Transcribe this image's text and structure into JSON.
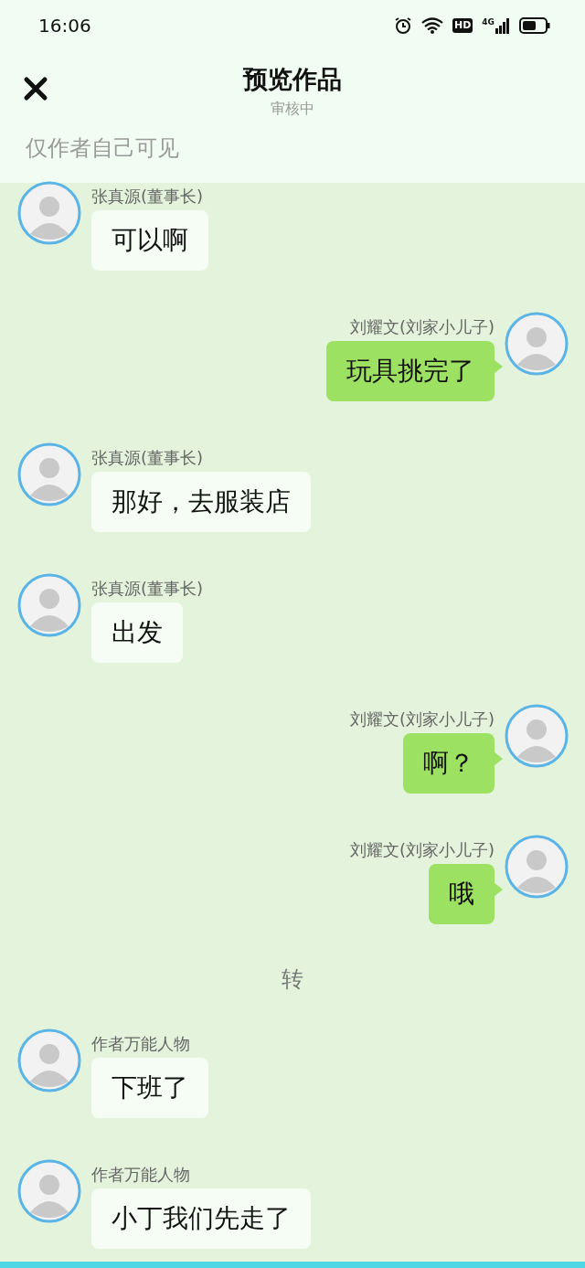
{
  "status_bar": {
    "time": "16:06",
    "hd_label": "HD",
    "network_label": "4G"
  },
  "header": {
    "title": "预览作品",
    "subtitle": "审核中"
  },
  "notice": "仅作者自己可见",
  "messages": [
    {
      "kind": "left",
      "sender": "张真源(董事长)",
      "text": "可以啊"
    },
    {
      "kind": "right",
      "sender": "刘耀文(刘家小儿子)",
      "text": "玩具挑完了"
    },
    {
      "kind": "left",
      "sender": "张真源(董事长)",
      "text": "那好，去服装店"
    },
    {
      "kind": "left",
      "sender": "张真源(董事长)",
      "text": "出发"
    },
    {
      "kind": "right",
      "sender": "刘耀文(刘家小儿子)",
      "text": "啊？"
    },
    {
      "kind": "right",
      "sender": "刘耀文(刘家小儿子)",
      "text": "哦"
    },
    {
      "kind": "divider",
      "text": "转"
    },
    {
      "kind": "left",
      "sender": "作者万能人物",
      "text": "下班了"
    },
    {
      "kind": "left",
      "sender": "作者万能人物",
      "text": "小丁我们先走了"
    }
  ]
}
